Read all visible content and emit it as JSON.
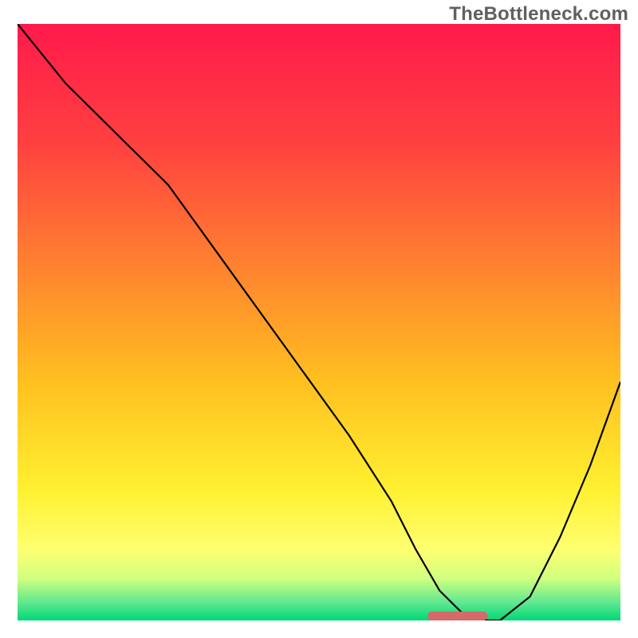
{
  "watermark": "TheBottleneck.com",
  "chart_data": {
    "type": "line",
    "title": "",
    "xlabel": "",
    "ylabel": "",
    "xlim": [
      0,
      100
    ],
    "ylim": [
      0,
      100
    ],
    "background": {
      "type": "vertical-gradient",
      "stops": [
        {
          "offset": 0.0,
          "color": "#ff1a4b"
        },
        {
          "offset": 0.2,
          "color": "#ff4040"
        },
        {
          "offset": 0.4,
          "color": "#ff8030"
        },
        {
          "offset": 0.6,
          "color": "#ffc020"
        },
        {
          "offset": 0.78,
          "color": "#fff030"
        },
        {
          "offset": 0.88,
          "color": "#ffff70"
        },
        {
          "offset": 0.93,
          "color": "#d0ff80"
        },
        {
          "offset": 0.97,
          "color": "#60e890"
        },
        {
          "offset": 1.0,
          "color": "#00d878"
        }
      ]
    },
    "series": [
      {
        "name": "bottleneck-curve",
        "color": "#000000",
        "x": [
          0,
          8,
          18,
          25,
          35,
          45,
          55,
          62,
          66,
          70,
          74,
          78,
          80,
          85,
          90,
          95,
          100
        ],
        "y": [
          100,
          90,
          80,
          73,
          59,
          45,
          31,
          20,
          12,
          5,
          1,
          0,
          0,
          4,
          14,
          26,
          40
        ]
      }
    ],
    "marker": {
      "name": "target-bar",
      "color": "#d46a6a",
      "x_start": 68,
      "x_end": 78,
      "y": 0,
      "thickness": 1.5
    }
  }
}
